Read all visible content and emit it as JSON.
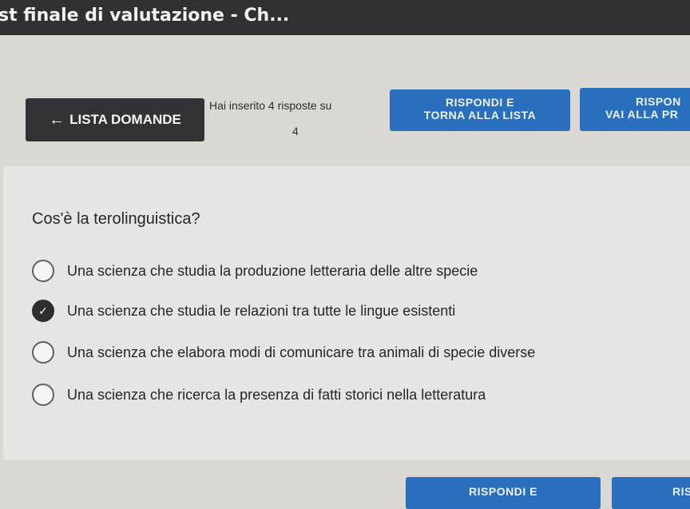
{
  "window": {
    "title": "st finale di valutazione - Ch..."
  },
  "toolbar": {
    "back_label": "LISTA DOMANDE",
    "back_icon": "arrow-left-icon",
    "info_text": "Hai inserito 4 risposte su",
    "info_total": "4",
    "answer_return_line1": "RISPONDI E",
    "answer_return_line2": "TORNA ALLA LISTA",
    "answer_next_line1": "RISPON",
    "answer_next_line2": "VAI ALLA PR"
  },
  "question": {
    "text": "Cos'è la terolinguistica?",
    "options": [
      {
        "label": "Una scienza che studia la produzione letteraria delle altre specie",
        "selected": false
      },
      {
        "label": "Una scienza che studia le relazioni tra tutte le lingue esistenti",
        "selected": true
      },
      {
        "label": "Una scienza che elabora modi di comunicare tra animali di specie diverse",
        "selected": false
      },
      {
        "label": "Una scienza che ricerca la presenza di fatti storici nella letteratura",
        "selected": false
      }
    ]
  },
  "footer": {
    "answer_label": "RISPONDI E",
    "next_label": "RIS"
  },
  "colors": {
    "accent": "#2a6fbe",
    "dark": "#303234"
  }
}
